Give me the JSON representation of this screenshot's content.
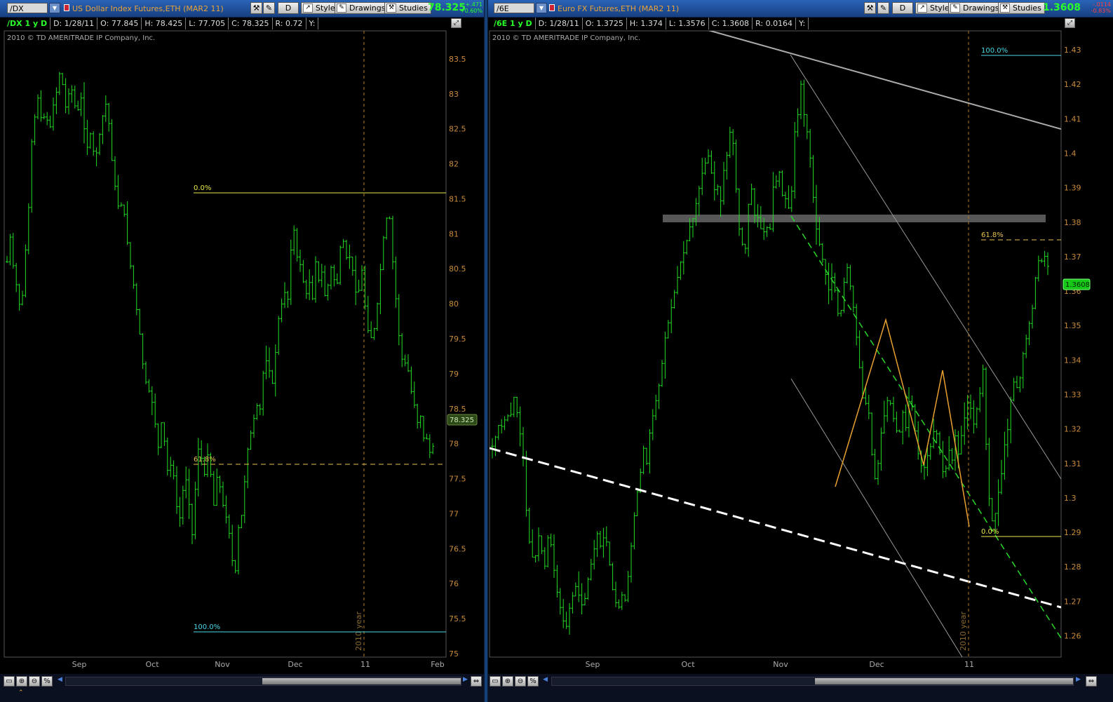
{
  "left": {
    "symbol": "/DX",
    "title": "US Dollar Index Futures,ETH (MAR2 11)",
    "buttons": {
      "period": "D",
      "style": "Style",
      "drawings": "Drawings",
      "studies": "Studies"
    },
    "last": "78.325",
    "change": "+.471",
    "change_pct": "+0.60%",
    "info": {
      "sym": "/DX 1 y D",
      "date": "D: 1/28/11",
      "open": "O: 77.845",
      "high": "H: 78.425",
      "low": "L: 77.705",
      "close": "C: 78.325",
      "range": "R: 0.72",
      "y": "Y:"
    },
    "copyright": "2010 © TD AMERITRADE IP Company, Inc.",
    "price_badge": "78.325",
    "year_label": "2010 year",
    "fib": {
      "top": "0.0%",
      "mid": "61.8%",
      "bottom": "100.0%"
    },
    "chart_data": {
      "type": "bar",
      "x_ticks": [
        "Sep",
        "Oct",
        "Nov",
        "Dec",
        "11",
        "Feb"
      ],
      "y_ticks": [
        "83.5",
        "83",
        "82.5",
        "82",
        "81.5",
        "81",
        "80.5",
        "80",
        "79.5",
        "79",
        "78.5",
        "78",
        "77.5",
        "77",
        "76.5",
        "76",
        "75.5",
        "75"
      ],
      "ylim": [
        74.95,
        83.9
      ],
      "close_path": [
        [
          0,
          80.6
        ],
        [
          5,
          81.0
        ],
        [
          10,
          80.4
        ],
        [
          15,
          80.2
        ],
        [
          20,
          79.8
        ],
        [
          25,
          80.6
        ],
        [
          30,
          81.2
        ],
        [
          35,
          82.3
        ],
        [
          40,
          82.7
        ],
        [
          45,
          83.0
        ],
        [
          50,
          82.5
        ],
        [
          55,
          82.8
        ],
        [
          60,
          82.4
        ],
        [
          65,
          82.8
        ],
        [
          70,
          83.0
        ],
        [
          75,
          83.3
        ],
        [
          80,
          83.1
        ],
        [
          85,
          82.7
        ],
        [
          90,
          83.2
        ],
        [
          95,
          82.9
        ],
        [
          100,
          82.7
        ],
        [
          105,
          83.0
        ],
        [
          110,
          82.5
        ],
        [
          115,
          82.2
        ],
        [
          120,
          82.5
        ],
        [
          125,
          82.0
        ],
        [
          130,
          82.3
        ],
        [
          135,
          82.6
        ],
        [
          140,
          82.9
        ],
        [
          145,
          82.6
        ],
        [
          150,
          82.0
        ],
        [
          155,
          81.6
        ],
        [
          160,
          81.3
        ],
        [
          165,
          81.5
        ],
        [
          170,
          81.0
        ],
        [
          175,
          80.6
        ],
        [
          180,
          80.3
        ],
        [
          185,
          79.9
        ],
        [
          190,
          79.5
        ],
        [
          195,
          79.0
        ],
        [
          200,
          78.8
        ],
        [
          205,
          78.7
        ],
        [
          210,
          78.4
        ],
        [
          215,
          77.9
        ],
        [
          220,
          78.3
        ],
        [
          225,
          78.0
        ],
        [
          230,
          77.5
        ],
        [
          235,
          77.8
        ],
        [
          240,
          77.3
        ],
        [
          245,
          76.8
        ],
        [
          250,
          77.3
        ],
        [
          255,
          77.5
        ],
        [
          260,
          77.1
        ],
        [
          265,
          76.6
        ],
        [
          270,
          77.7
        ],
        [
          275,
          78.1
        ],
        [
          280,
          77.4
        ],
        [
          285,
          77.9
        ],
        [
          290,
          77.6
        ],
        [
          295,
          77.1
        ],
        [
          300,
          77.6
        ],
        [
          305,
          77.3
        ],
        [
          310,
          77.0
        ],
        [
          315,
          76.9
        ],
        [
          320,
          76.4
        ],
        [
          325,
          76.1
        ],
        [
          330,
          76.8
        ],
        [
          335,
          77.0
        ],
        [
          340,
          77.6
        ],
        [
          345,
          78.1
        ],
        [
          350,
          78.2
        ],
        [
          355,
          78.6
        ],
        [
          360,
          78.4
        ],
        [
          365,
          79.0
        ],
        [
          370,
          79.2
        ],
        [
          375,
          79.0
        ],
        [
          380,
          78.8
        ],
        [
          385,
          79.7
        ],
        [
          390,
          79.9
        ],
        [
          395,
          80.2
        ],
        [
          400,
          80.0
        ],
        [
          405,
          80.8
        ],
        [
          410,
          81.1
        ],
        [
          415,
          80.5
        ],
        [
          420,
          80.6
        ],
        [
          425,
          80.0
        ],
        [
          430,
          80.4
        ],
        [
          435,
          80.0
        ],
        [
          440,
          80.6
        ],
        [
          445,
          80.3
        ],
        [
          450,
          80.5
        ],
        [
          455,
          79.9
        ],
        [
          460,
          80.6
        ],
        [
          465,
          80.4
        ],
        [
          470,
          80.2
        ],
        [
          475,
          80.8
        ],
        [
          480,
          80.9
        ],
        [
          485,
          80.6
        ],
        [
          490,
          80.7
        ],
        [
          495,
          80.3
        ],
        [
          500,
          80.0
        ],
        [
          505,
          80.6
        ],
        [
          510,
          80.0
        ],
        [
          515,
          79.6
        ],
        [
          520,
          79.5
        ],
        [
          525,
          79.7
        ],
        [
          530,
          80.2
        ],
        [
          535,
          80.8
        ],
        [
          540,
          81.2
        ],
        [
          545,
          81.3
        ],
        [
          550,
          80.6
        ],
        [
          555,
          80.0
        ],
        [
          560,
          79.4
        ],
        [
          565,
          79.1
        ],
        [
          570,
          79.2
        ],
        [
          575,
          78.8
        ],
        [
          580,
          78.6
        ],
        [
          585,
          78.3
        ],
        [
          590,
          78.4
        ],
        [
          595,
          78.0
        ],
        [
          600,
          78.1
        ],
        [
          605,
          77.7
        ],
        [
          610,
          78.3
        ]
      ]
    }
  },
  "right": {
    "symbol": "/6E",
    "title": "Euro FX Futures,ETH (MAR2 11)",
    "buttons": {
      "period": "D",
      "style": "Style",
      "drawings": "Drawings",
      "studies": "Studies"
    },
    "last": "1.3608",
    "change": "-.0114",
    "change_pct": "-0.83%",
    "info": {
      "sym": "/6E 1 y D",
      "date": "D: 1/28/11",
      "open": "O: 1.3725",
      "high": "H: 1.374",
      "low": "L: 1.3576",
      "close": "C: 1.3608",
      "range": "R: 0.0164",
      "y": "Y:"
    },
    "copyright": "2010 © TD AMERITRADE IP Company, Inc.",
    "price_badge": "1.3608",
    "year_label": "2010 year",
    "fib": {
      "top": "100.0%",
      "mid": "61.8%",
      "bottom": "0.0%"
    },
    "chart_data": {
      "type": "bar",
      "x_ticks": [
        "Sep",
        "Oct",
        "Nov",
        "Dec",
        "11"
      ],
      "y_ticks": [
        "1.43",
        "1.42",
        "1.41",
        "1.4",
        "1.39",
        "1.38",
        "1.37",
        "1.36",
        "1.35",
        "1.34",
        "1.33",
        "1.32",
        "1.31",
        "1.3",
        "1.29",
        "1.28",
        "1.27",
        "1.26"
      ],
      "ylim": [
        1.2538,
        1.4355
      ],
      "close_path": [
        [
          0,
          1.315
        ],
        [
          5,
          1.318
        ],
        [
          10,
          1.322
        ],
        [
          15,
          1.32
        ],
        [
          20,
          1.325
        ],
        [
          25,
          1.322
        ],
        [
          30,
          1.33
        ],
        [
          35,
          1.325
        ],
        [
          40,
          1.318
        ],
        [
          45,
          1.31
        ],
        [
          50,
          1.29
        ],
        [
          55,
          1.285
        ],
        [
          60,
          1.28
        ],
        [
          65,
          1.29
        ],
        [
          70,
          1.285
        ],
        [
          75,
          1.28
        ],
        [
          80,
          1.29
        ],
        [
          85,
          1.285
        ],
        [
          90,
          1.275
        ],
        [
          95,
          1.27
        ],
        [
          100,
          1.265
        ],
        [
          105,
          1.262
        ],
        [
          110,
          1.268
        ],
        [
          115,
          1.272
        ],
        [
          120,
          1.275
        ],
        [
          125,
          1.27
        ],
        [
          130,
          1.268
        ],
        [
          135,
          1.275
        ],
        [
          140,
          1.28
        ],
        [
          145,
          1.285
        ],
        [
          150,
          1.29
        ],
        [
          155,
          1.285
        ],
        [
          160,
          1.29
        ],
        [
          165,
          1.285
        ],
        [
          170,
          1.275
        ],
        [
          175,
          1.27
        ],
        [
          180,
          1.268
        ],
        [
          185,
          1.272
        ],
        [
          190,
          1.27
        ],
        [
          195,
          1.28
        ],
        [
          200,
          1.29
        ],
        [
          205,
          1.3
        ],
        [
          210,
          1.305
        ],
        [
          215,
          1.315
        ],
        [
          220,
          1.31
        ],
        [
          225,
          1.32
        ],
        [
          230,
          1.325
        ],
        [
          235,
          1.33
        ],
        [
          240,
          1.335
        ],
        [
          245,
          1.345
        ],
        [
          250,
          1.35
        ],
        [
          255,
          1.355
        ],
        [
          260,
          1.36
        ],
        [
          265,
          1.365
        ],
        [
          270,
          1.37
        ],
        [
          275,
          1.372
        ],
        [
          280,
          1.378
        ],
        [
          285,
          1.38
        ],
        [
          290,
          1.385
        ],
        [
          295,
          1.39
        ],
        [
          300,
          1.395
        ],
        [
          305,
          1.398
        ],
        [
          310,
          1.4
        ],
        [
          315,
          1.388
        ],
        [
          320,
          1.392
        ],
        [
          325,
          1.385
        ],
        [
          330,
          1.395
        ],
        [
          335,
          1.4
        ],
        [
          340,
          1.408
        ],
        [
          345,
          1.4
        ],
        [
          350,
          1.38
        ],
        [
          355,
          1.375
        ],
        [
          360,
          1.37
        ],
        [
          365,
          1.385
        ],
        [
          370,
          1.39
        ],
        [
          375,
          1.38
        ],
        [
          380,
          1.382
        ],
        [
          385,
          1.375
        ],
        [
          390,
          1.38
        ],
        [
          395,
          1.375
        ],
        [
          400,
          1.39
        ],
        [
          405,
          1.392
        ],
        [
          410,
          1.395
        ],
        [
          415,
          1.385
        ],
        [
          420,
          1.388
        ],
        [
          425,
          1.38
        ],
        [
          430,
          1.405
        ],
        [
          435,
          1.41
        ],
        [
          440,
          1.42
        ],
        [
          445,
          1.41
        ],
        [
          450,
          1.405
        ],
        [
          455,
          1.395
        ],
        [
          460,
          1.38
        ],
        [
          465,
          1.375
        ],
        [
          470,
          1.37
        ],
        [
          475,
          1.365
        ],
        [
          480,
          1.36
        ],
        [
          485,
          1.365
        ],
        [
          490,
          1.358
        ],
        [
          495,
          1.35
        ],
        [
          500,
          1.36
        ],
        [
          505,
          1.368
        ],
        [
          510,
          1.362
        ],
        [
          515,
          1.355
        ],
        [
          520,
          1.345
        ],
        [
          525,
          1.335
        ],
        [
          530,
          1.325
        ],
        [
          535,
          1.33
        ],
        [
          540,
          1.315
        ],
        [
          545,
          1.305
        ],
        [
          550,
          1.31
        ],
        [
          555,
          1.32
        ],
        [
          560,
          1.325
        ],
        [
          565,
          1.33
        ],
        [
          570,
          1.325
        ],
        [
          575,
          1.32
        ],
        [
          580,
          1.318
        ],
        [
          585,
          1.325
        ],
        [
          590,
          1.32
        ],
        [
          595,
          1.33
        ],
        [
          600,
          1.325
        ],
        [
          605,
          1.315
        ],
        [
          610,
          1.31
        ],
        [
          615,
          1.308
        ],
        [
          620,
          1.312
        ],
        [
          625,
          1.315
        ],
        [
          630,
          1.32
        ],
        [
          635,
          1.318
        ],
        [
          640,
          1.31
        ],
        [
          645,
          1.305
        ],
        [
          650,
          1.315
        ],
        [
          655,
          1.31
        ],
        [
          660,
          1.318
        ],
        [
          665,
          1.312
        ],
        [
          670,
          1.32
        ],
        [
          675,
          1.325
        ],
        [
          680,
          1.33
        ],
        [
          685,
          1.32
        ],
        [
          690,
          1.325
        ],
        [
          695,
          1.33
        ],
        [
          700,
          1.338
        ],
        [
          705,
          1.31
        ],
        [
          710,
          1.295
        ],
        [
          715,
          1.292
        ],
        [
          720,
          1.3
        ],
        [
          725,
          1.305
        ],
        [
          730,
          1.315
        ],
        [
          735,
          1.32
        ],
        [
          740,
          1.33
        ],
        [
          745,
          1.335
        ],
        [
          750,
          1.33
        ],
        [
          755,
          1.34
        ],
        [
          760,
          1.345
        ],
        [
          765,
          1.35
        ],
        [
          770,
          1.355
        ],
        [
          775,
          1.365
        ],
        [
          780,
          1.37
        ],
        [
          785,
          1.368
        ],
        [
          790,
          1.372
        ],
        [
          795,
          1.36
        ]
      ]
    }
  },
  "bottom": {
    "zoom_pct": "%"
  }
}
